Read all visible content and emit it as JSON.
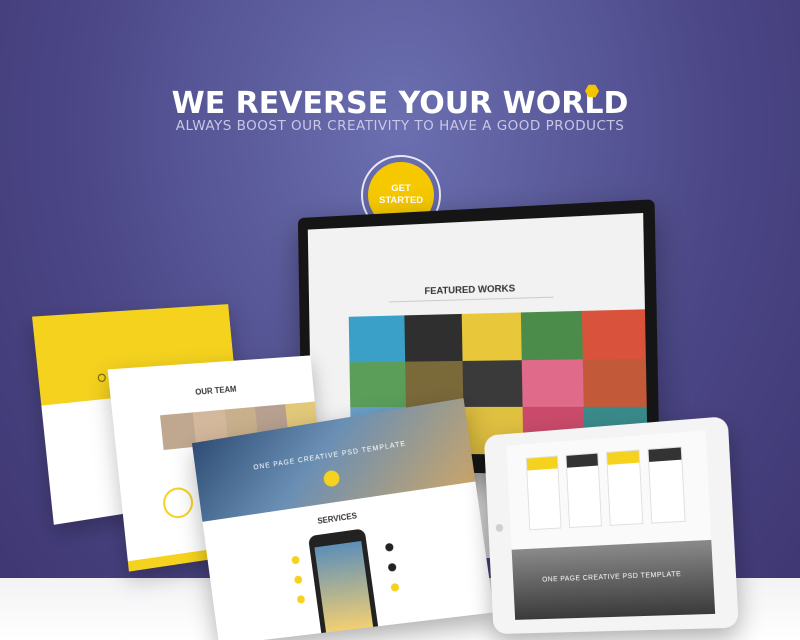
{
  "hero": {
    "title": "WE REVERSE YOUR WORLD",
    "subtitle": "ALWAYS BOOST OUR CREATIVITY TO HAVE A GOOD PRODUCTS",
    "cta_line1": "GET",
    "cta_line2": "STARTED"
  },
  "colors": {
    "accent": "#f5c800",
    "background_top": "#6b6fb0",
    "background_bottom": "#3d3570",
    "floor": "#f3f3f5"
  },
  "devices": {
    "monitor_heading": "FEATURED WORKS",
    "team_heading": "OUR TEAM",
    "services_hero_title": "ONE PAGE CREATIVE PSD TEMPLATE",
    "services_heading": "SERVICES",
    "tablet_city_title": "ONE PAGE CREATIVE PSD TEMPLATE"
  },
  "monitor_tiles": [
    "#3aa0c8",
    "#2f2f2f",
    "#e8c73a",
    "#4c8c4a",
    "#d9533c",
    "#5a9e5a",
    "#7a6a3a",
    "#3a3a3a",
    "#e06a8a",
    "#c25a3a",
    "#6aa0c8",
    "#8a5a9a",
    "#e0c040",
    "#c94a6a",
    "#3a8a8a"
  ],
  "team_photo_colors": [
    "#bfa88f",
    "#d4b89c",
    "#c9b08c",
    "#b8a090",
    "#e2c87a"
  ]
}
